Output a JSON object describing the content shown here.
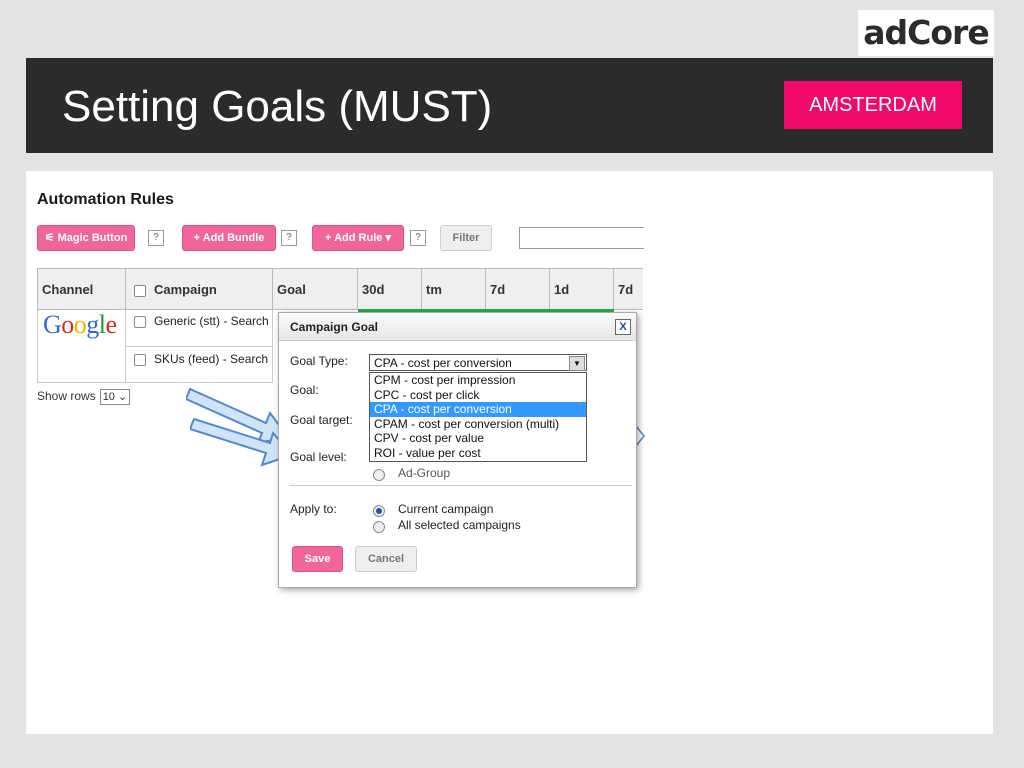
{
  "brand": {
    "logo": "adCore"
  },
  "slide": {
    "title": "Setting Goals (MUST)",
    "city_badge": "AMSTERDAM"
  },
  "app": {
    "section_title": "Automation Rules",
    "toolbar": {
      "magic_button": "Magic Button",
      "add_bundle": "+ Add Bundle",
      "add_rule": "+ Add Rule",
      "help": "?",
      "filter": "Filter"
    },
    "table": {
      "columns": [
        "Channel",
        "Campaign",
        "Goal",
        "30d",
        "tm",
        "7d",
        "1d",
        "7d"
      ],
      "rows": [
        {
          "channel_logo": "Google",
          "campaign": "Generic (stt) - Search"
        },
        {
          "channel_logo": "",
          "campaign": "SKUs (feed) - Search"
        }
      ]
    },
    "pagination": {
      "label": "Show rows",
      "value": "10"
    }
  },
  "dialog": {
    "title": "Campaign Goal",
    "close": "X",
    "labels": {
      "goal_type": "Goal Type:",
      "goal": "Goal:",
      "goal_target": "Goal target:",
      "goal_level": "Goal level:",
      "apply_to": "Apply to:"
    },
    "goal_type_selected": "CPA - cost per conversion",
    "goal_type_options": [
      "CPM - cost per impression",
      "CPC - cost per click",
      "CPA - cost per conversion",
      "CPAM - cost per conversion (multi)",
      "CPV - cost per value",
      "ROI - value per cost"
    ],
    "goal_level_option": "Ad-Group",
    "apply_to_options": [
      "Current campaign",
      "All selected campaigns"
    ],
    "save": "Save",
    "cancel": "Cancel"
  },
  "colors": {
    "accent": "#f0096b",
    "header_bg": "#2b2b2b",
    "selection": "#3399ff"
  }
}
